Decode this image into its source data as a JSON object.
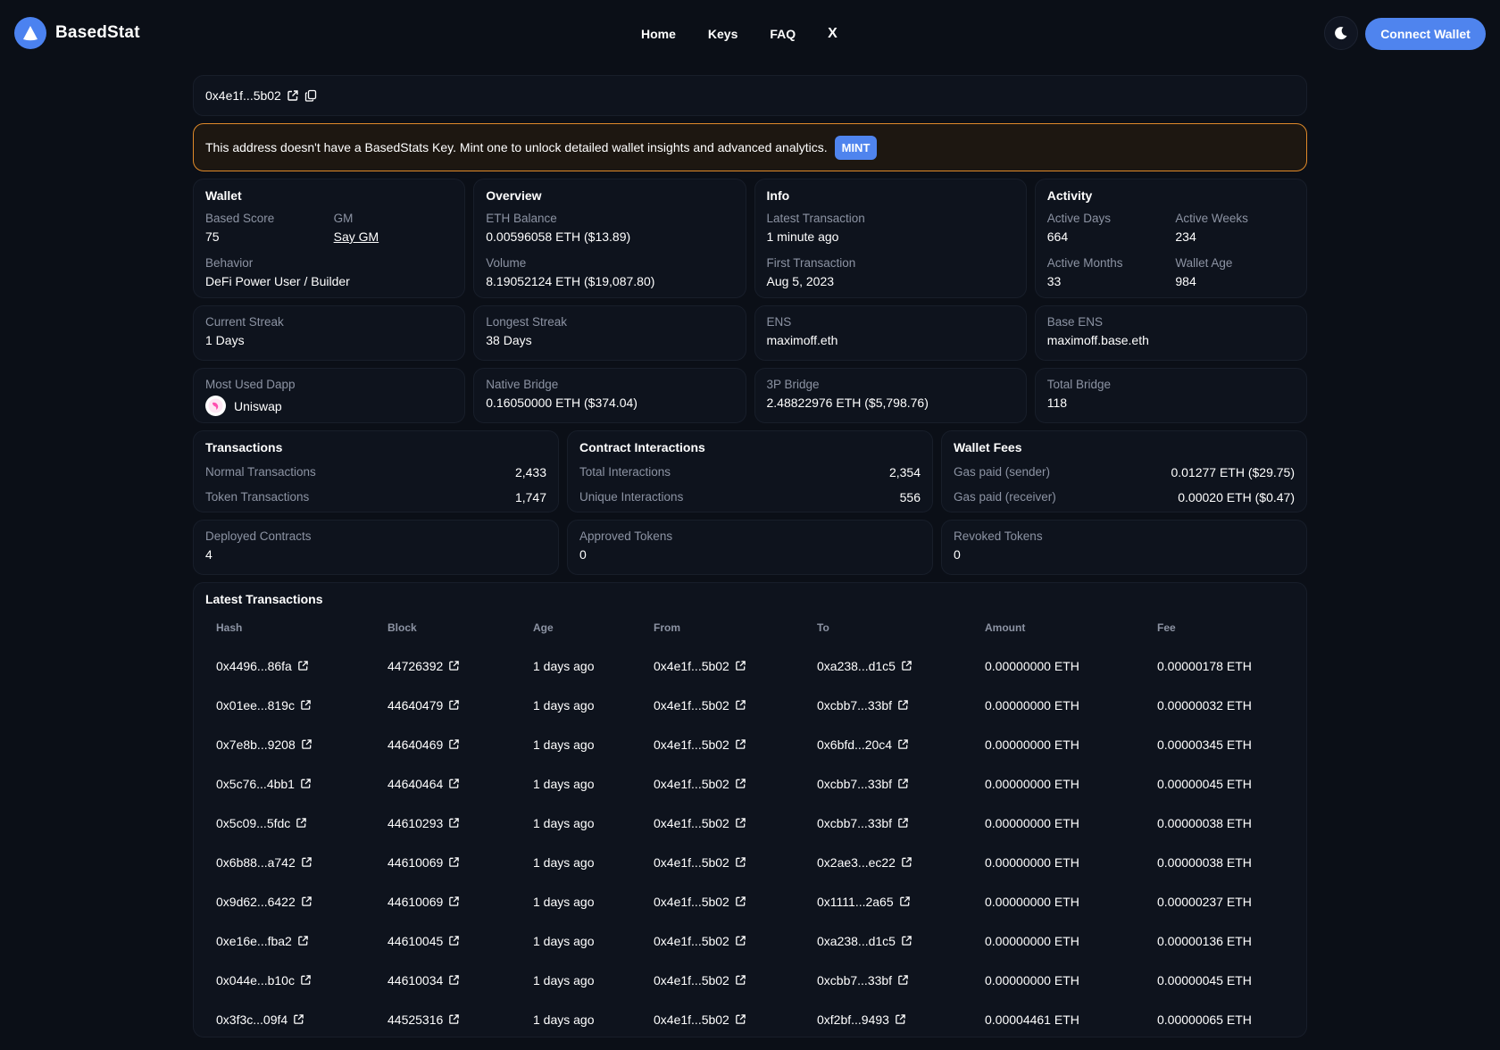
{
  "header": {
    "brand_name": "BasedStat",
    "nav": [
      "Home",
      "Keys",
      "FAQ"
    ],
    "x_label": "X",
    "connect_label": "Connect Wallet"
  },
  "address": {
    "short": "0x4e1f...5b02"
  },
  "alert": {
    "message": "This address doesn't have a BasedStats Key. Mint one to unlock detailed wallet insights and advanced analytics.",
    "mint_label": "MINT"
  },
  "wallet": {
    "title": "Wallet",
    "based_score_label": "Based Score",
    "based_score": "75",
    "gm_label": "GM",
    "gm_link": "Say GM",
    "behavior_label": "Behavior",
    "behavior": "DeFi Power User / Builder"
  },
  "overview": {
    "title": "Overview",
    "eth_balance_label": "ETH Balance",
    "eth_balance": "0.00596058 ETH ($13.89)",
    "volume_label": "Volume",
    "volume": "8.19052124 ETH ($19,087.80)"
  },
  "info": {
    "title": "Info",
    "latest_label": "Latest Transaction",
    "latest": "1 minute ago",
    "first_label": "First Transaction",
    "first": "Aug 5, 2023"
  },
  "activity": {
    "title": "Activity",
    "days_label": "Active Days",
    "days": "664",
    "weeks_label": "Active Weeks",
    "weeks": "234",
    "months_label": "Active Months",
    "months": "33",
    "age_label": "Wallet Age",
    "age": "984"
  },
  "row2": [
    {
      "label": "Current Streak",
      "value": "1 Days"
    },
    {
      "label": "Longest Streak",
      "value": "38 Days"
    },
    {
      "label": "ENS",
      "value": "maximoff.eth"
    },
    {
      "label": "Base ENS",
      "value": "maximoff.base.eth"
    }
  ],
  "row3": {
    "dapp_label": "Most Used Dapp",
    "dapp": "Uniswap",
    "native_label": "Native Bridge",
    "native": "0.16050000 ETH ($374.04)",
    "thirdp_label": "3P Bridge",
    "thirdp": "2.48822976 ETH ($5,798.76)",
    "total_label": "Total Bridge",
    "total": "118"
  },
  "transactions": {
    "title": "Transactions",
    "normal_label": "Normal Transactions",
    "normal": "2,433",
    "token_label": "Token Transactions",
    "token": "1,747"
  },
  "contracts": {
    "title": "Contract Interactions",
    "total_label": "Total Interactions",
    "total": "2,354",
    "unique_label": "Unique Interactions",
    "unique": "556"
  },
  "fees": {
    "title": "Wallet Fees",
    "sender_label": "Gas paid (sender)",
    "sender": "0.01277 ETH ($29.75)",
    "receiver_label": "Gas paid (receiver)",
    "receiver": "0.00020 ETH ($0.47)"
  },
  "row5": [
    {
      "label": "Deployed Contracts",
      "value": "4"
    },
    {
      "label": "Approved Tokens",
      "value": "0"
    },
    {
      "label": "Revoked Tokens",
      "value": "0"
    }
  ],
  "latest_tx": {
    "title": "Latest Transactions",
    "columns": [
      "Hash",
      "Block",
      "Age",
      "From",
      "To",
      "Amount",
      "Fee"
    ],
    "rows": [
      [
        "0x4496...86fa",
        "44726392",
        "1 days ago",
        "0x4e1f...5b02",
        "0xa238...d1c5",
        "0.00000000 ETH",
        "0.00000178 ETH"
      ],
      [
        "0x01ee...819c",
        "44640479",
        "1 days ago",
        "0x4e1f...5b02",
        "0xcbb7...33bf",
        "0.00000000 ETH",
        "0.00000032 ETH"
      ],
      [
        "0x7e8b...9208",
        "44640469",
        "1 days ago",
        "0x4e1f...5b02",
        "0x6bfd...20c4",
        "0.00000000 ETH",
        "0.00000345 ETH"
      ],
      [
        "0x5c76...4bb1",
        "44640464",
        "1 days ago",
        "0x4e1f...5b02",
        "0xcbb7...33bf",
        "0.00000000 ETH",
        "0.00000045 ETH"
      ],
      [
        "0x5c09...5fdc",
        "44610293",
        "1 days ago",
        "0x4e1f...5b02",
        "0xcbb7...33bf",
        "0.00000000 ETH",
        "0.00000038 ETH"
      ],
      [
        "0x6b88...a742",
        "44610069",
        "1 days ago",
        "0x4e1f...5b02",
        "0x2ae3...ec22",
        "0.00000000 ETH",
        "0.00000038 ETH"
      ],
      [
        "0x9d62...6422",
        "44610069",
        "1 days ago",
        "0x4e1f...5b02",
        "0x1111...2a65",
        "0.00000000 ETH",
        "0.00000237 ETH"
      ],
      [
        "0xe16e...fba2",
        "44610045",
        "1 days ago",
        "0x4e1f...5b02",
        "0xa238...d1c5",
        "0.00000000 ETH",
        "0.00000136 ETH"
      ],
      [
        "0x044e...b10c",
        "44610034",
        "1 days ago",
        "0x4e1f...5b02",
        "0xcbb7...33bf",
        "0.00000000 ETH",
        "0.00000045 ETH"
      ],
      [
        "0x3f3c...09f4",
        "44525316",
        "1 days ago",
        "0x4e1f...5b02",
        "0xf2bf...9493",
        "0.00004461 ETH",
        "0.00000065 ETH"
      ]
    ]
  },
  "colors": {
    "background": "#0b0f17",
    "card": "#0e131d",
    "accent": "#4f84ee",
    "alert_border": "#e08a2a",
    "muted_text": "#8c93a3"
  },
  "icons": {
    "brand": "triangle-logo-icon",
    "theme": "moon-icon",
    "external": "external-link-icon",
    "copy": "copy-icon",
    "dapp": "uniswap-icon"
  }
}
